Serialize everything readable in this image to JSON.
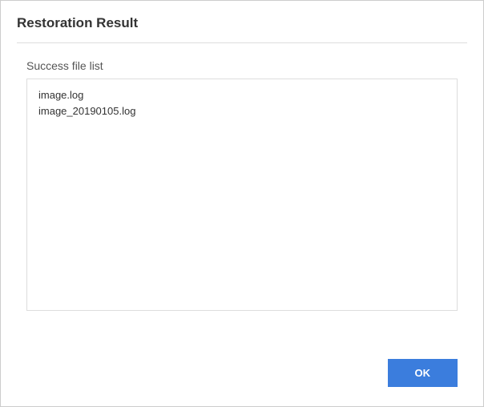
{
  "dialog": {
    "title": "Restoration Result",
    "section_label": "Success file list",
    "files": [
      "image.log",
      "image_20190105.log"
    ],
    "ok_label": "OK"
  }
}
